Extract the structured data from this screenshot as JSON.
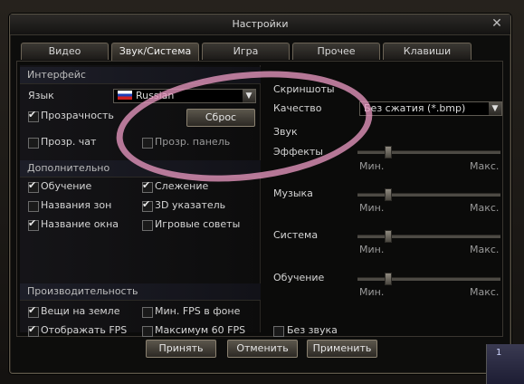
{
  "window": {
    "title": "Настройки"
  },
  "tabs": [
    "Видео",
    "Звук/Система",
    "Игра",
    "Прочее",
    "Клавиши"
  ],
  "active_tab": "Звук/Система",
  "interface": {
    "header": "Интерфейс",
    "language_label": "Язык",
    "language_value": "Russian",
    "transparency_label": "Прозрачность",
    "transparency_checked": true,
    "reset_button": "Сброс",
    "trans_chat_label": "Прозр. чат",
    "trans_chat_checked": false,
    "trans_panel_label": "Прозр. панель",
    "trans_panel_checked": false
  },
  "additional": {
    "header": "Дополнительно",
    "items": [
      {
        "label": "Обучение",
        "checked": true
      },
      {
        "label": "Слежение",
        "checked": true
      },
      {
        "label": "Названия зон",
        "checked": false
      },
      {
        "label": "3D указатель",
        "checked": true
      },
      {
        "label": "Название окна",
        "checked": true
      },
      {
        "label": "Игровые советы",
        "checked": false
      }
    ]
  },
  "performance": {
    "header": "Производительность",
    "items": [
      {
        "label": "Вещи на земле",
        "checked": true
      },
      {
        "label": "Мин. FPS в фоне",
        "checked": false
      },
      {
        "label": "Отображать FPS",
        "checked": true
      },
      {
        "label": "Максимум 60 FPS",
        "checked": false
      }
    ]
  },
  "screenshots": {
    "header": "Скриншоты",
    "quality_label": "Качество",
    "quality_value": "Без сжатия (*.bmp)"
  },
  "sound": {
    "header": "Звук",
    "min_label": "Мин.",
    "max_label": "Макс.",
    "sliders": [
      {
        "label": "Эффекты",
        "value": 0.2
      },
      {
        "label": "Музыка",
        "value": 0.2
      },
      {
        "label": "Система",
        "value": 0.2
      },
      {
        "label": "Обучение",
        "value": 0.2
      }
    ],
    "mute_label": "Без звука",
    "mute_checked": false
  },
  "buttons": {
    "accept": "Принять",
    "cancel": "Отменить",
    "apply": "Применить"
  },
  "corner_text": "1",
  "colors": {
    "highlight_ring": "#e696be",
    "window_border": "#5a5447"
  }
}
